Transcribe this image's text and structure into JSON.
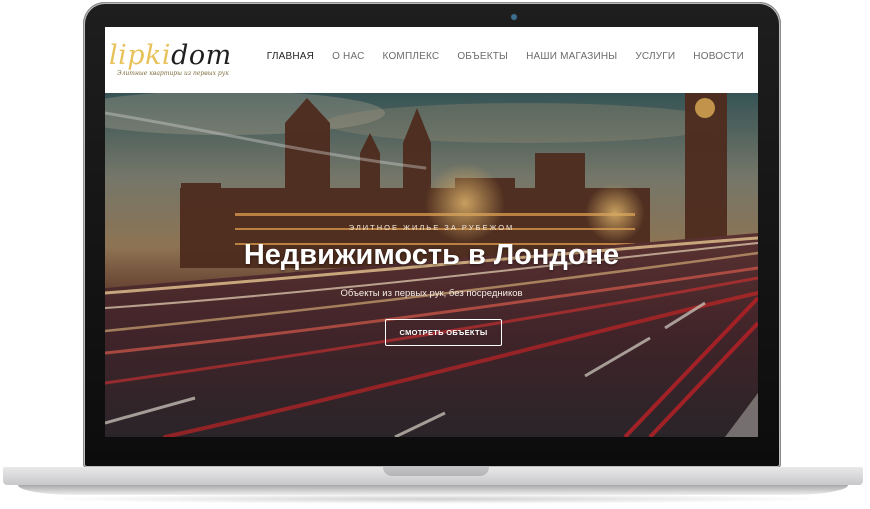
{
  "brand": {
    "logo_part1": "lipki",
    "logo_part2": "dom",
    "tagline": "Элитные квартиры из первых рук"
  },
  "nav": {
    "items": [
      "ГЛАВНАЯ",
      "О НАС",
      "КОМПЛЕКС",
      "ОБЪЕКТЫ",
      "НАШИ МАГАЗИНЫ",
      "УСЛУГИ",
      "НОВОСТИ"
    ],
    "active_index": 0
  },
  "hero": {
    "kicker": "ЭЛИТНОЕ ЖИЛЬЕ ЗА РУБЕЖОМ",
    "title": "Недвижимость в Лондоне",
    "subtitle": "Объекты из первых рук, без посредников",
    "button_label": "СМОТРЕТЬ ОБЪЕКТЫ",
    "image": "london-parliament-night-traffic"
  },
  "colors": {
    "logo_gold": "#e7c25a",
    "logo_dark": "#1f1f1f",
    "menu_text": "#6b6b6b",
    "hero_text": "#ffffff"
  }
}
